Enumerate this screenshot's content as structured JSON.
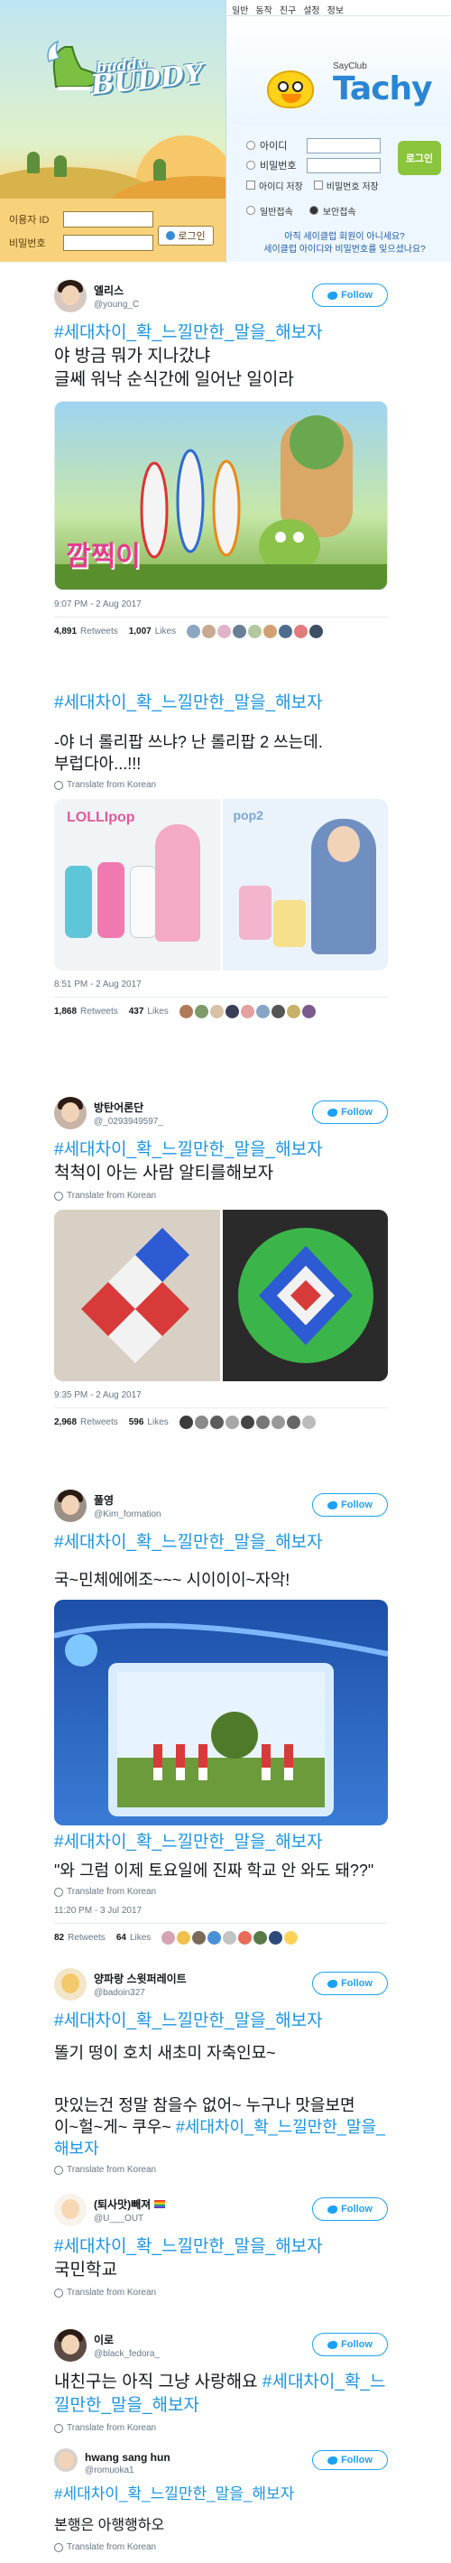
{
  "buddy": {
    "logo_small": "buddy",
    "logo_big": "BUDDY",
    "id_label": "이용자 ID",
    "pw_label": "비밀번호",
    "login_button": "로그인"
  },
  "tachy": {
    "menu": [
      "일반",
      "동작",
      "친구",
      "설정",
      "정보"
    ],
    "sayclub": "SayClub",
    "title": "Tachy",
    "id_label": "아이디",
    "pw_label": "비밀번호",
    "save_id": "아이디 저장",
    "save_pw": "비밀번호 저장",
    "mode_normal": "일반접속",
    "mode_secure": "보안접속",
    "login_button": "로그인",
    "link1": "아직 세이클럽 회원이 아니세요?",
    "link2": "세이클럽 아이디와 비밀번호를 잊으셨나요?"
  },
  "tweets": [
    {
      "display_name": "엘리스",
      "username": "@young_C",
      "follow": "Follow",
      "hashtag": "#세대차이_확_느낄만한_말을_해보자",
      "text": "야 방금 뭐가 지나갔냐\n글쎄 워낙 순식간에 일어난 일이라",
      "translate": "Translate from Korean",
      "media_caption": "깜찍이",
      "time": "9:07 PM - 2 Aug 2017",
      "retweets_count": "4,891",
      "retweets_label": "Retweets",
      "likes_count": "1,007",
      "likes_label": "Likes"
    },
    {
      "hashtag": "#세대차이_확_느낄만한_말을_해보자",
      "text": "-야 너 롤리팝 쓰냐? 난 롤리팝 2  쓰는데.\n부럽다아...!!!",
      "translate": "Translate from Korean",
      "media_caption1": "LOLLIpop",
      "media_caption2": "pop2",
      "time": "8:51 PM - 2 Aug 2017",
      "retweets_count": "1,868",
      "retweets_label": "Retweets",
      "likes_count": "437",
      "likes_label": "Likes"
    },
    {
      "display_name": "방탄어론단",
      "username": "@_0293949597_",
      "follow": "Follow",
      "hashtag": "#세대차이_확_느낄만한_말을_해보자",
      "text": "척척이 아는 사람 알티를해보자",
      "translate": "Translate from Korean",
      "time": "9:35 PM - 2 Aug 2017",
      "retweets_count": "2,968",
      "retweets_label": "Retweets",
      "likes_count": "596",
      "likes_label": "Likes"
    },
    {
      "display_name": "풀영",
      "username": "@Kim_formation",
      "follow": "Follow",
      "hashtag": "#세대차이_확_느낄만한_말을_해보자",
      "text": "국~민체에에조~~~ 시이이이~자악!",
      "hashtag2": "#세대차이_확_느낄만한_말을_해보자",
      "text2": "\"와 그럼 이제 토요일에 진짜 학교 안 와도 돼??\"",
      "translate": "Translate from Korean",
      "time": "11:20 PM - 3 Jul 2017",
      "retweets_count": "82",
      "retweets_label": "Retweets",
      "likes_count": "64",
      "likes_label": "Likes"
    },
    {
      "display_name": "양파랑 스윗퍼레이트",
      "username": "@badoin327",
      "follow": "Follow",
      "hashtag": "#세대차이_확_느낄만한_말을_해보자",
      "text": "똘기 떵이 호치 새초미 자축인묘~",
      "text2": "맛있는건 정말 참을수 없어~ 누구나 맛을보면\n이~헐~게~ 쿠우~ ",
      "hashtag2": "#세대차이_확_느낄만한_말을_해보자",
      "translate": "Translate from Korean"
    },
    {
      "display_name": "(퇴사맛)빼져",
      "username": "@U___OUT",
      "follow": "Follow",
      "hashtag": "#세대차이_확_느낄만한_말을_해보자",
      "text": "국민학교",
      "translate": "Translate from Korean"
    },
    {
      "display_name": "이로",
      "username": "@black_fedora_",
      "follow": "Follow",
      "text": "내친구는 아직 그냥 사랑해요 ",
      "hashtag": "#세대차이_확_느낄만한_말을_해보자",
      "translate": "Translate from Korean"
    },
    {
      "display_name": "hwang sang hun",
      "username": "@romuoka1",
      "follow": "Follow",
      "hashtag": "#세대차이_확_느낄만한_말을_해보자",
      "text": "본행은 아행행하오",
      "translate": "Translate from Korean"
    }
  ],
  "colors": {
    "link_blue": "#1b95e0",
    "follow_blue": "#1da1f2",
    "meta_gray": "#657786"
  }
}
